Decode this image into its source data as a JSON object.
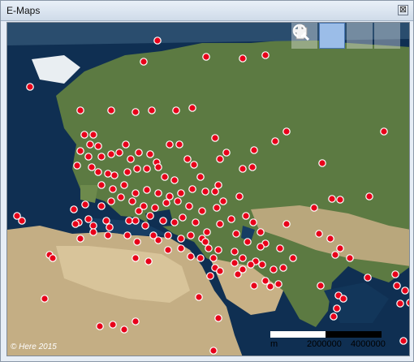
{
  "window": {
    "title": "E-Maps",
    "close_glyph": "⊠"
  },
  "map": {
    "copyright": "© Here 2015",
    "scale_labels": [
      "m",
      "2000000",
      "4000000"
    ],
    "marker_color": "#e8001a",
    "tools": [
      {
        "name": "pan-hand-icon",
        "active": false
      },
      {
        "name": "zoom-in-magnifier-icon",
        "active": true
      },
      {
        "name": "plus-icon",
        "active": false
      },
      {
        "name": "minus-icon",
        "active": false
      }
    ]
  }
}
